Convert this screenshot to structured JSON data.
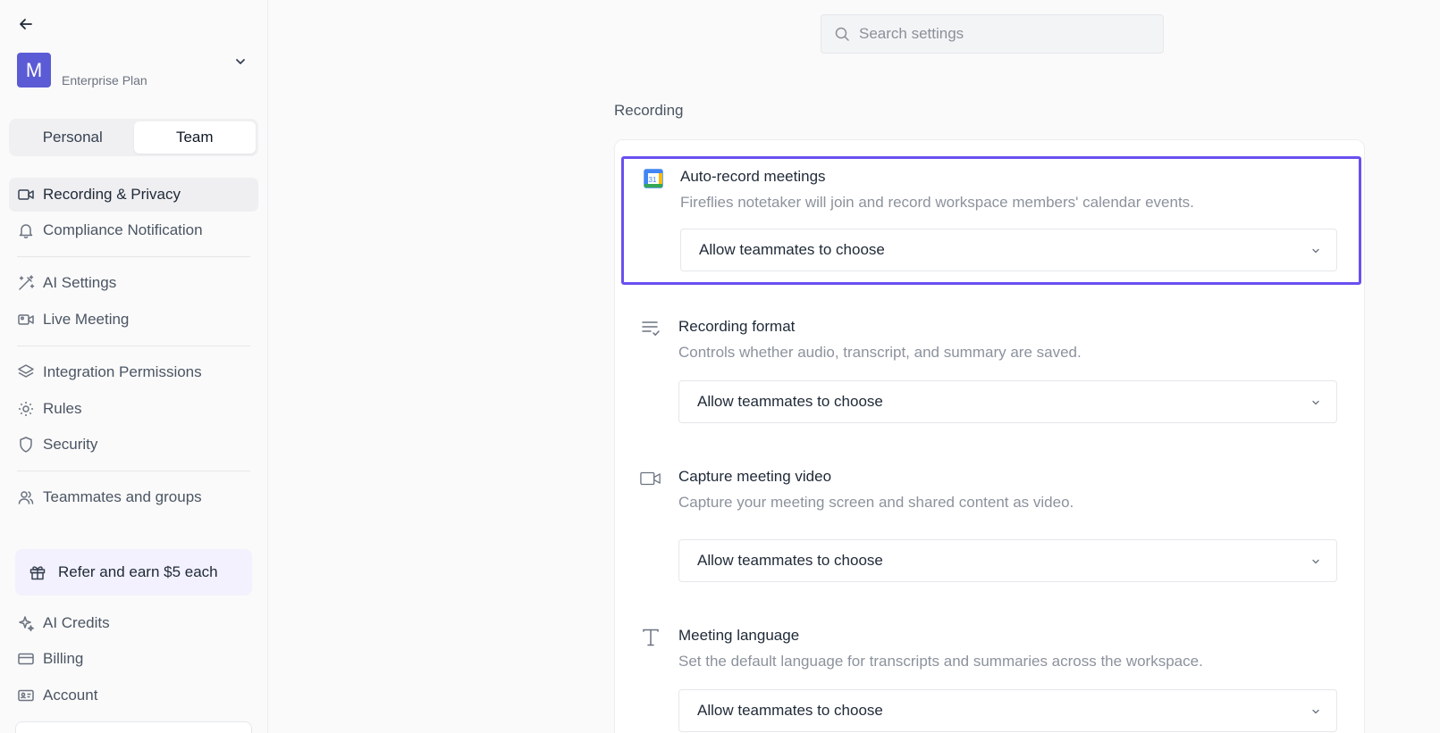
{
  "sidebar": {
    "account": {
      "avatar_letter": "M",
      "email": "",
      "plan": "Enterprise Plan"
    },
    "segment": {
      "personal": "Personal",
      "team": "Team"
    },
    "items": [
      {
        "label": "Recording & Privacy",
        "icon": "video-icon"
      },
      {
        "label": "Compliance Notification",
        "icon": "bell-icon"
      },
      {
        "label": "AI Settings",
        "icon": "magic-wand-icon"
      },
      {
        "label": "Live Meeting",
        "icon": "video-live-icon"
      },
      {
        "label": "Integration Permissions",
        "icon": "layers-icon"
      },
      {
        "label": "Rules",
        "icon": "gear-rules-icon"
      },
      {
        "label": "Security",
        "icon": "shield-icon"
      },
      {
        "label": "Teammates and groups",
        "icon": "users-icon"
      },
      {
        "label": "AI Credits",
        "icon": "sparkles-icon"
      },
      {
        "label": "Billing",
        "icon": "credit-card-icon"
      },
      {
        "label": "Account",
        "icon": "id-card-icon"
      }
    ],
    "refer": {
      "label": "Refer and earn $5 each",
      "icon": "gift-icon"
    }
  },
  "search": {
    "placeholder": "Search settings"
  },
  "section": {
    "title": "Recording"
  },
  "settings": [
    {
      "title": "Auto-record meetings",
      "description": "Fireflies notetaker will join and record workspace members' calendar events.",
      "value": "Allow teammates to choose",
      "icon": "google-calendar-icon"
    },
    {
      "title": "Recording format",
      "description": "Controls whether audio, transcript, and summary are saved.",
      "value": "Allow teammates to choose",
      "icon": "list-check-icon"
    },
    {
      "title": "Capture meeting video",
      "description": "Capture your meeting screen and shared content as video.",
      "value": "Allow teammates to choose",
      "icon": "video-camera-icon"
    },
    {
      "title": "Meeting language",
      "description": "Set the default language for transcripts and summaries across the workspace.",
      "value": "Allow teammates to choose",
      "icon": "text-icon"
    }
  ],
  "colors": {
    "accent": "#5b5bd6",
    "highlight": "#6a4ff0",
    "active_bg": "#efeff2",
    "refer_bg": "#f2f1fd"
  }
}
